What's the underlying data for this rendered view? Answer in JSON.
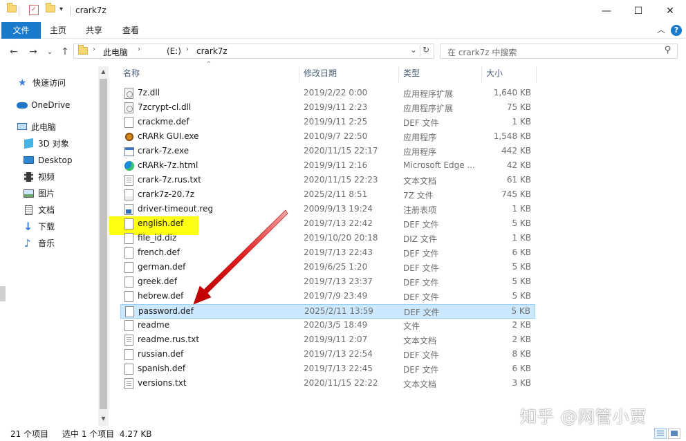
{
  "window": {
    "title": "crark7z",
    "minimize": "—",
    "maximize": "☐",
    "close": "✕",
    "qa_dropdown": "▾"
  },
  "ribbon": {
    "tabs": [
      "文件",
      "主页",
      "共享",
      "查看"
    ],
    "collapse": "︿",
    "help": "?"
  },
  "nav": {
    "back": "←",
    "forward": "→",
    "recent": "⌄",
    "up": "↑",
    "breadcrumb": [
      "此电脑",
      "(E:)",
      "crark7z"
    ],
    "sep": "›",
    "dropdown": "⌄",
    "refresh": "↻",
    "search_placeholder": "在 crark7z 中搜索",
    "search_icon": "⚲"
  },
  "sidebar": {
    "items": [
      {
        "label": "快速访问",
        "icon": "star-icon"
      },
      {
        "label": "OneDrive",
        "icon": "cloud-icon"
      },
      {
        "label": "此电脑",
        "icon": "computer-icon"
      },
      {
        "label": "3D 对象",
        "icon": "cube-icon"
      },
      {
        "label": "Desktop",
        "icon": "desktop-icon"
      },
      {
        "label": "视频",
        "icon": "video-icon"
      },
      {
        "label": "图片",
        "icon": "picture-icon"
      },
      {
        "label": "文档",
        "icon": "document-icon"
      },
      {
        "label": "下载",
        "icon": "download-icon"
      },
      {
        "label": "音乐",
        "icon": "music-icon"
      }
    ]
  },
  "columns": {
    "name": "名称",
    "date": "修改日期",
    "type": "类型",
    "size": "大小",
    "sort_indicator": "^"
  },
  "files": [
    {
      "name": "7z.dll",
      "date": "2019/2/22 0:00",
      "type": "应用程序扩展",
      "size": "1,640 KB",
      "icon": "dll"
    },
    {
      "name": "7zcrypt-cl.dll",
      "date": "2019/9/11 2:23",
      "type": "应用程序扩展",
      "size": "75 KB",
      "icon": "dll"
    },
    {
      "name": "crackme.def",
      "date": "2019/9/11 2:25",
      "type": "DEF 文件",
      "size": "1 KB",
      "icon": "file"
    },
    {
      "name": "cRARk GUI.exe",
      "date": "2010/9/7 22:50",
      "type": "应用程序",
      "size": "1,548 KB",
      "icon": "rar"
    },
    {
      "name": "crark-7z.exe",
      "date": "2020/11/15 22:17",
      "type": "应用程序",
      "size": "442 KB",
      "icon": "exe"
    },
    {
      "name": "cRARk-7z.html",
      "date": "2019/9/11 2:16",
      "type": "Microsoft Edge ...",
      "size": "42 KB",
      "icon": "edge"
    },
    {
      "name": "crark-7z.rus.txt",
      "date": "2020/11/15 22:23",
      "type": "文本文档",
      "size": "61 KB",
      "icon": "txt"
    },
    {
      "name": "crark7z-20.7z",
      "date": "2025/2/11 8:51",
      "type": "7Z 文件",
      "size": "745 KB",
      "icon": "sevenz"
    },
    {
      "name": "driver-timeout.reg",
      "date": "2009/9/13 19:24",
      "type": "注册表项",
      "size": "1 KB",
      "icon": "reg"
    },
    {
      "name": "english.def",
      "date": "2019/7/13 22:42",
      "type": "DEF 文件",
      "size": "5 KB",
      "icon": "file"
    },
    {
      "name": "file_id.diz",
      "date": "2019/10/20 20:18",
      "type": "DIZ 文件",
      "size": "1 KB",
      "icon": "file"
    },
    {
      "name": "french.def",
      "date": "2019/7/13 22:43",
      "type": "DEF 文件",
      "size": "6 KB",
      "icon": "file"
    },
    {
      "name": "german.def",
      "date": "2019/6/25 1:20",
      "type": "DEF 文件",
      "size": "5 KB",
      "icon": "file"
    },
    {
      "name": "greek.def",
      "date": "2019/7/13 23:37",
      "type": "DEF 文件",
      "size": "5 KB",
      "icon": "file"
    },
    {
      "name": "hebrew.def",
      "date": "2019/7/9 23:49",
      "type": "DEF 文件",
      "size": "5 KB",
      "icon": "file"
    },
    {
      "name": "password.def",
      "date": "2025/2/11 13:59",
      "type": "DEF 文件",
      "size": "5 KB",
      "icon": "file",
      "selected": true
    },
    {
      "name": "readme",
      "date": "2020/3/5 18:49",
      "type": "文件",
      "size": "2 KB",
      "icon": "file"
    },
    {
      "name": "readme.rus.txt",
      "date": "2019/9/11 2:07",
      "type": "文本文档",
      "size": "2 KB",
      "icon": "txt"
    },
    {
      "name": "russian.def",
      "date": "2019/7/13 22:54",
      "type": "DEF 文件",
      "size": "8 KB",
      "icon": "file"
    },
    {
      "name": "spanish.def",
      "date": "2019/7/13 22:45",
      "type": "DEF 文件",
      "size": "6 KB",
      "icon": "file"
    },
    {
      "name": "versions.txt",
      "date": "2020/11/15 22:22",
      "type": "文本文档",
      "size": "3 KB",
      "icon": "txt"
    }
  ],
  "status": {
    "count": "21 个项目",
    "selection": "选中 1 个项目  4.27 KB"
  },
  "watermark": "知乎 @网管小贾",
  "colors": {
    "accent": "#1979ca",
    "selection_bg": "#cce8ff",
    "highlight": "#ffff14",
    "arrow": "#e01010"
  }
}
